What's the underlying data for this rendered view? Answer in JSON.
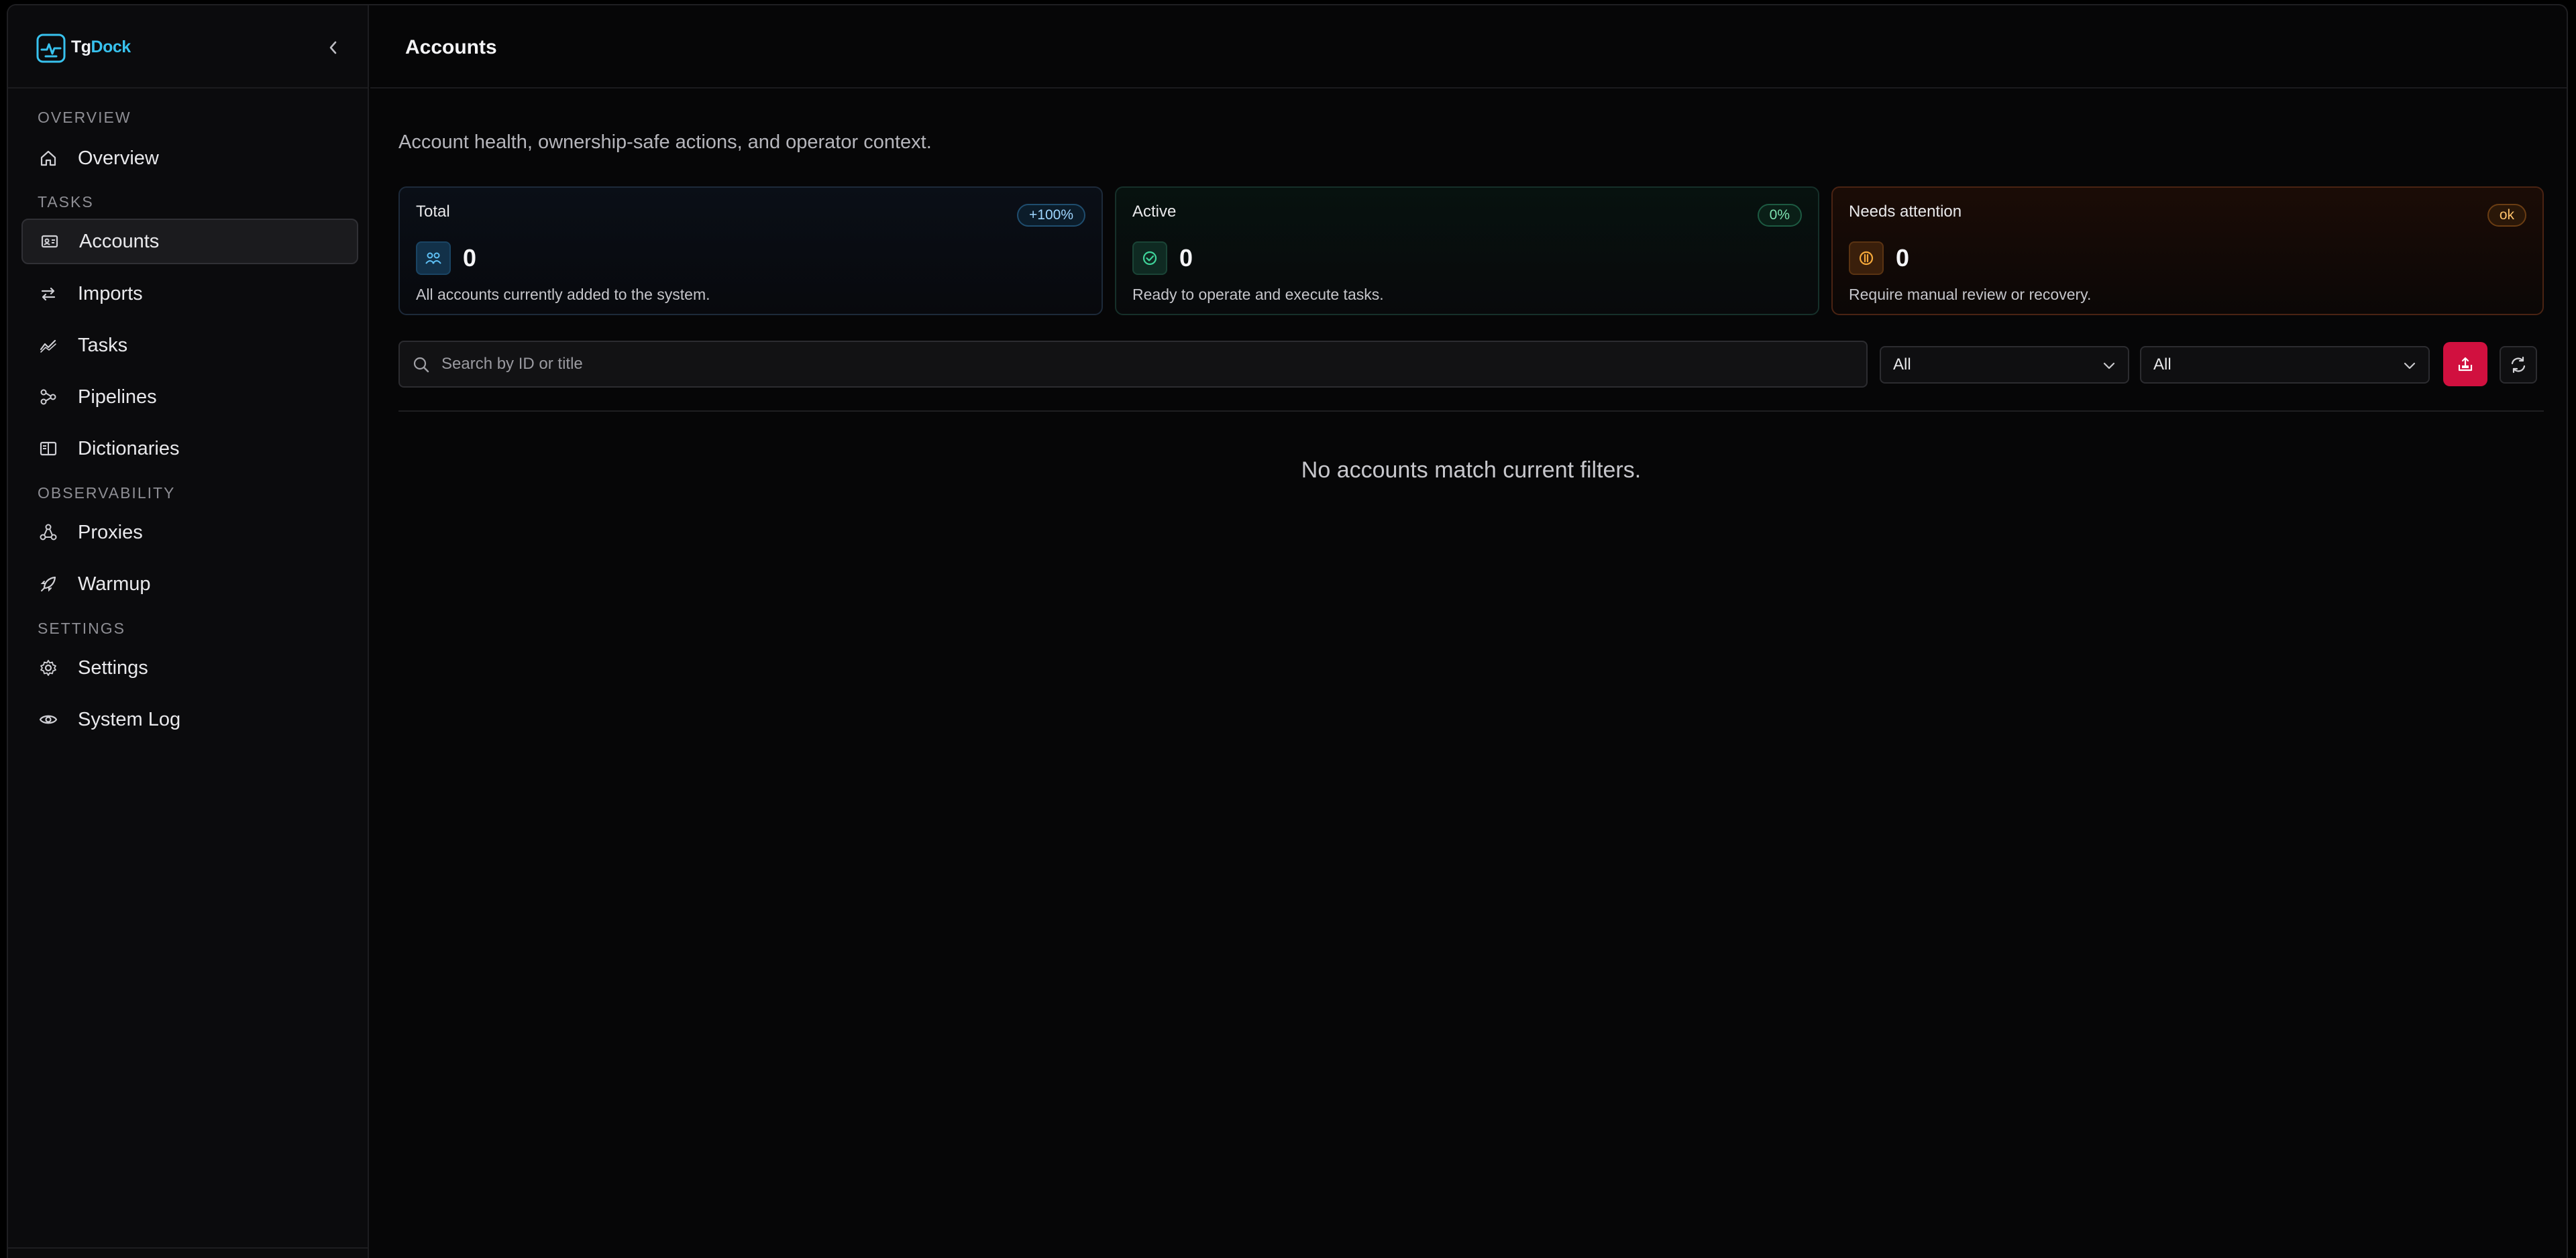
{
  "brand": {
    "name_part1": "Tg",
    "name_part2": "Dock",
    "accent": "#38c2ee"
  },
  "sidebar": {
    "sections": [
      {
        "label": "OVERVIEW"
      },
      {
        "label": "TASKS"
      },
      {
        "label": "OBSERVABILITY"
      },
      {
        "label": "SETTINGS"
      }
    ],
    "items": [
      {
        "label": "Overview",
        "icon": "home-icon"
      },
      {
        "label": "Accounts",
        "icon": "id-card-icon",
        "active": true
      },
      {
        "label": "Imports",
        "icon": "arrows-swap-icon"
      },
      {
        "label": "Tasks",
        "icon": "activity-icon"
      },
      {
        "label": "Pipelines",
        "icon": "workflow-icon"
      },
      {
        "label": "Dictionaries",
        "icon": "book-icon"
      },
      {
        "label": "Proxies",
        "icon": "network-icon"
      },
      {
        "label": "Warmup",
        "icon": "rocket-icon"
      },
      {
        "label": "Settings",
        "icon": "gear-icon"
      },
      {
        "label": "System Log",
        "icon": "eye-icon"
      }
    ]
  },
  "header": {
    "title": "Accounts"
  },
  "main": {
    "subtitle": "Account health, ownership-safe actions, and operator context.",
    "cards": [
      {
        "title": "Total",
        "badge": "+100%",
        "value": "0",
        "description": "All accounts currently added to the system.",
        "icon": "users-icon",
        "tone": "#38a8e8"
      },
      {
        "title": "Active",
        "badge": "0%",
        "value": "0",
        "description": "Ready to operate and execute tasks.",
        "icon": "check-circle-icon",
        "tone": "#2fbf86"
      },
      {
        "title": "Needs attention",
        "badge": "ok",
        "value": "0",
        "description": "Require manual review or recovery.",
        "icon": "alert-circle-icon",
        "tone": "#f0a030"
      }
    ],
    "search": {
      "placeholder": "Search by ID or title",
      "value": ""
    },
    "filters": [
      {
        "selected": "All"
      },
      {
        "selected": "All"
      }
    ],
    "actions": {
      "danger_color": "#d1103f"
    },
    "empty_message": "No accounts match current filters."
  }
}
